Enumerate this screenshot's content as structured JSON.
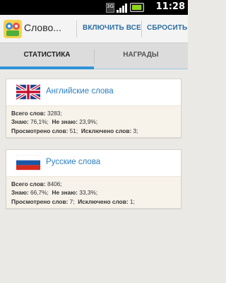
{
  "status_bar": {
    "network": "3G",
    "time": "11:28"
  },
  "action_bar": {
    "title": "Слово...",
    "include_all": "ВКЛЮЧИТЬ ВСЕ",
    "reset": "СБРОСИТЬ"
  },
  "tabs": [
    {
      "label": "СТАТИСТИКА",
      "active": true
    },
    {
      "label": "НАГРАДЫ",
      "active": false
    }
  ],
  "cards": [
    {
      "language": "Английские слова",
      "flag": "uk-flag",
      "total_label": "Всего слов:",
      "total_value": "3283;",
      "know_label": "Знаю:",
      "know_value": "76,1%;",
      "dont_know_label": "Не знаю:",
      "dont_know_value": "23,9%;",
      "viewed_label": "Просмотрено слов:",
      "viewed_value": "51;",
      "excluded_label": "Исключено слов:",
      "excluded_value": "3;"
    },
    {
      "language": "Русские слова",
      "flag": "russia-flag",
      "total_label": "Всего слов:",
      "total_value": "8406;",
      "know_label": "Знаю:",
      "know_value": "66,7%;",
      "dont_know_label": "Не знаю:",
      "dont_know_value": "33,3%;",
      "viewed_label": "Просмотрено слов:",
      "viewed_value": "7;",
      "excluded_label": "Исключено слов:",
      "excluded_value": "1;"
    }
  ],
  "colors": {
    "accent": "#2f93d6",
    "link": "#2c7fc1",
    "background": "#ebe9e6"
  }
}
